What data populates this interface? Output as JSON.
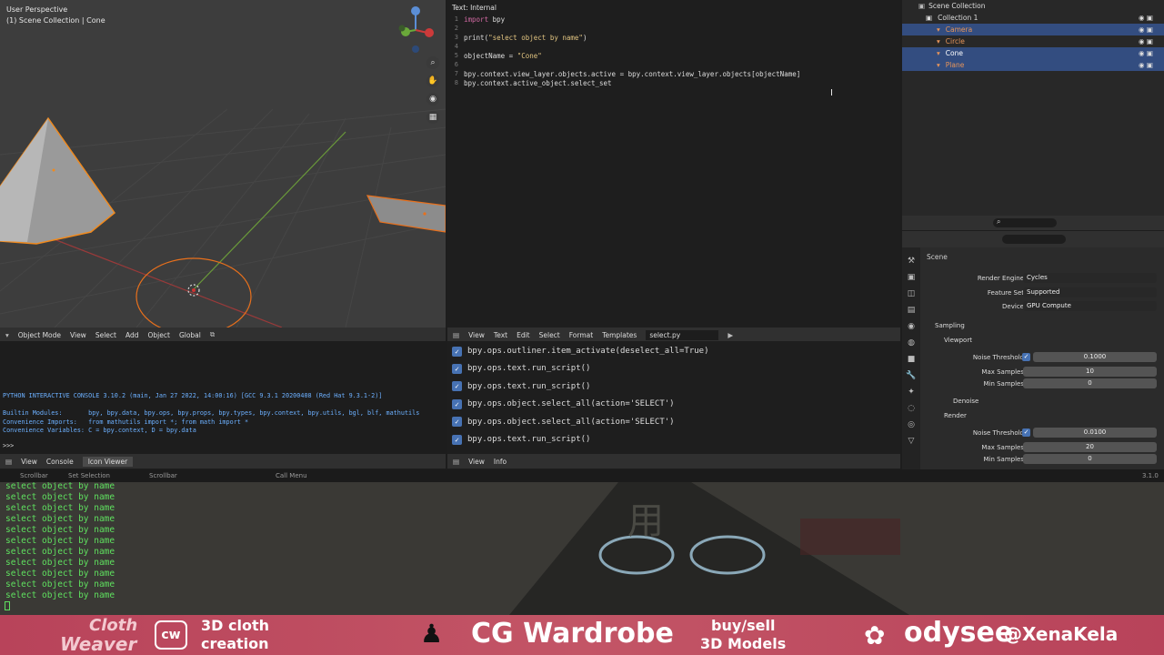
{
  "viewport": {
    "title": "User Perspective",
    "subtitle": "(1) Scene Collection | Cone",
    "nav_icons": [
      "zoom-icon",
      "hand-icon",
      "camera-icon",
      "grid-icon"
    ],
    "header": {
      "mode": "Object Mode",
      "menus": [
        "View",
        "Select",
        "Add",
        "Object"
      ],
      "transform": "Global"
    }
  },
  "text_editor": {
    "title": "Text: Internal",
    "lines": [
      {
        "n": "1",
        "parts": [
          {
            "t": "import",
            "c": "kw"
          },
          {
            "t": " bpy",
            "c": ""
          }
        ]
      },
      {
        "n": "2",
        "parts": []
      },
      {
        "n": "3",
        "parts": [
          {
            "t": "print(",
            "c": ""
          },
          {
            "t": "\"select object by name\"",
            "c": "str"
          },
          {
            "t": ")",
            "c": ""
          }
        ]
      },
      {
        "n": "4",
        "parts": []
      },
      {
        "n": "5",
        "parts": [
          {
            "t": "objectName = ",
            "c": ""
          },
          {
            "t": "\"Cone\"",
            "c": "str"
          }
        ]
      },
      {
        "n": "6",
        "parts": []
      },
      {
        "n": "7",
        "parts": [
          {
            "t": "bpy.context.view_layer.objects.active = bpy.context.view_layer.objects[objectName]",
            "c": ""
          }
        ]
      },
      {
        "n": "8",
        "parts": [
          {
            "t": "bpy.context.active_object.select_set",
            "c": ""
          }
        ]
      }
    ],
    "header": {
      "menus": [
        "View",
        "Text",
        "Edit",
        "Select",
        "Format",
        "Templates"
      ],
      "filename": "select.py"
    }
  },
  "outliner": {
    "root": "Scene Collection",
    "items": [
      {
        "label": "Collection 1",
        "indent": 1,
        "sel": false,
        "color": "#dddddd"
      },
      {
        "label": "Camera",
        "indent": 2,
        "sel": true,
        "color": "#e7955a"
      },
      {
        "label": "Circle",
        "indent": 2,
        "sel": false,
        "color": "#e7955a"
      },
      {
        "label": "Cone",
        "indent": 2,
        "sel": true,
        "color": "#ffffff"
      },
      {
        "label": "Plane",
        "indent": 2,
        "sel": true,
        "color": "#e7955a"
      }
    ]
  },
  "properties": {
    "context": "Scene",
    "render_engine": {
      "label": "Render Engine",
      "value": "Cycles"
    },
    "feature_set": {
      "label": "Feature Set",
      "value": "Supported"
    },
    "device": {
      "label": "Device",
      "value": "GPU Compute"
    },
    "sampling": "Sampling",
    "viewport": "Viewport",
    "vp_noise": {
      "label": "Noise Threshold",
      "value": "0.1000"
    },
    "vp_max": {
      "label": "Max Samples",
      "value": "10"
    },
    "vp_min": {
      "label": "Min Samples",
      "value": "0"
    },
    "denoise": "Denoise",
    "render": "Render",
    "r_noise": {
      "label": "Noise Threshold",
      "value": "0.0100"
    },
    "r_max": {
      "label": "Max Samples",
      "value": "20"
    },
    "r_min": {
      "label": "Min Samples",
      "value": "0"
    }
  },
  "console": {
    "lines": [
      "PYTHON INTERACTIVE CONSOLE 3.10.2 (main, Jan 27 2022, 14:00:16) [GCC 9.3.1 20200408 (Red Hat 9.3.1-2)]",
      "",
      "Builtin Modules:       bpy, bpy.data, bpy.ops, bpy.props, bpy.types, bpy.context, bpy.utils, bgl, blf, mathutils",
      "Convenience Imports:   from mathutils import *; from math import *",
      "Convenience Variables: C = bpy.context, D = bpy.data"
    ],
    "prompt": ">>> ",
    "header": {
      "menus": [
        "View",
        "Console"
      ],
      "tab": "Icon Viewer"
    }
  },
  "info": {
    "rows": [
      "bpy.ops.outliner.item_activate(deselect_all=True)",
      "bpy.ops.text.run_script()",
      "bpy.ops.text.run_script()",
      "bpy.ops.object.select_all(action='SELECT')",
      "bpy.ops.object.select_all(action='SELECT')",
      "bpy.ops.text.run_script()"
    ],
    "header": {
      "menus": [
        "View",
        "Info"
      ]
    }
  },
  "status": {
    "left1": "Scrollbar",
    "left2": "Set Selection",
    "left3": "Scrollbar",
    "left4": "Call Menu",
    "version": "3.1.0"
  },
  "terminal": {
    "lines": [
      "select object by name",
      "select object by name",
      "select object by name",
      "select object by name",
      "select object by name",
      "select object by name",
      "select object by name",
      "select object by name",
      "select object by name",
      "select object by name",
      "select object by name"
    ],
    "bg_text": "用"
  },
  "banner": {
    "logo1_a": "Cloth",
    "logo1_b": "Weaver",
    "cw": "cw",
    "cloth_a": "3D cloth",
    "cloth_b": "creation",
    "brand": "CG Wardrobe",
    "buy_a": "buy/sell",
    "buy_b": "3D Models",
    "odysee": "odysee",
    "handle": "@XenaKela"
  }
}
